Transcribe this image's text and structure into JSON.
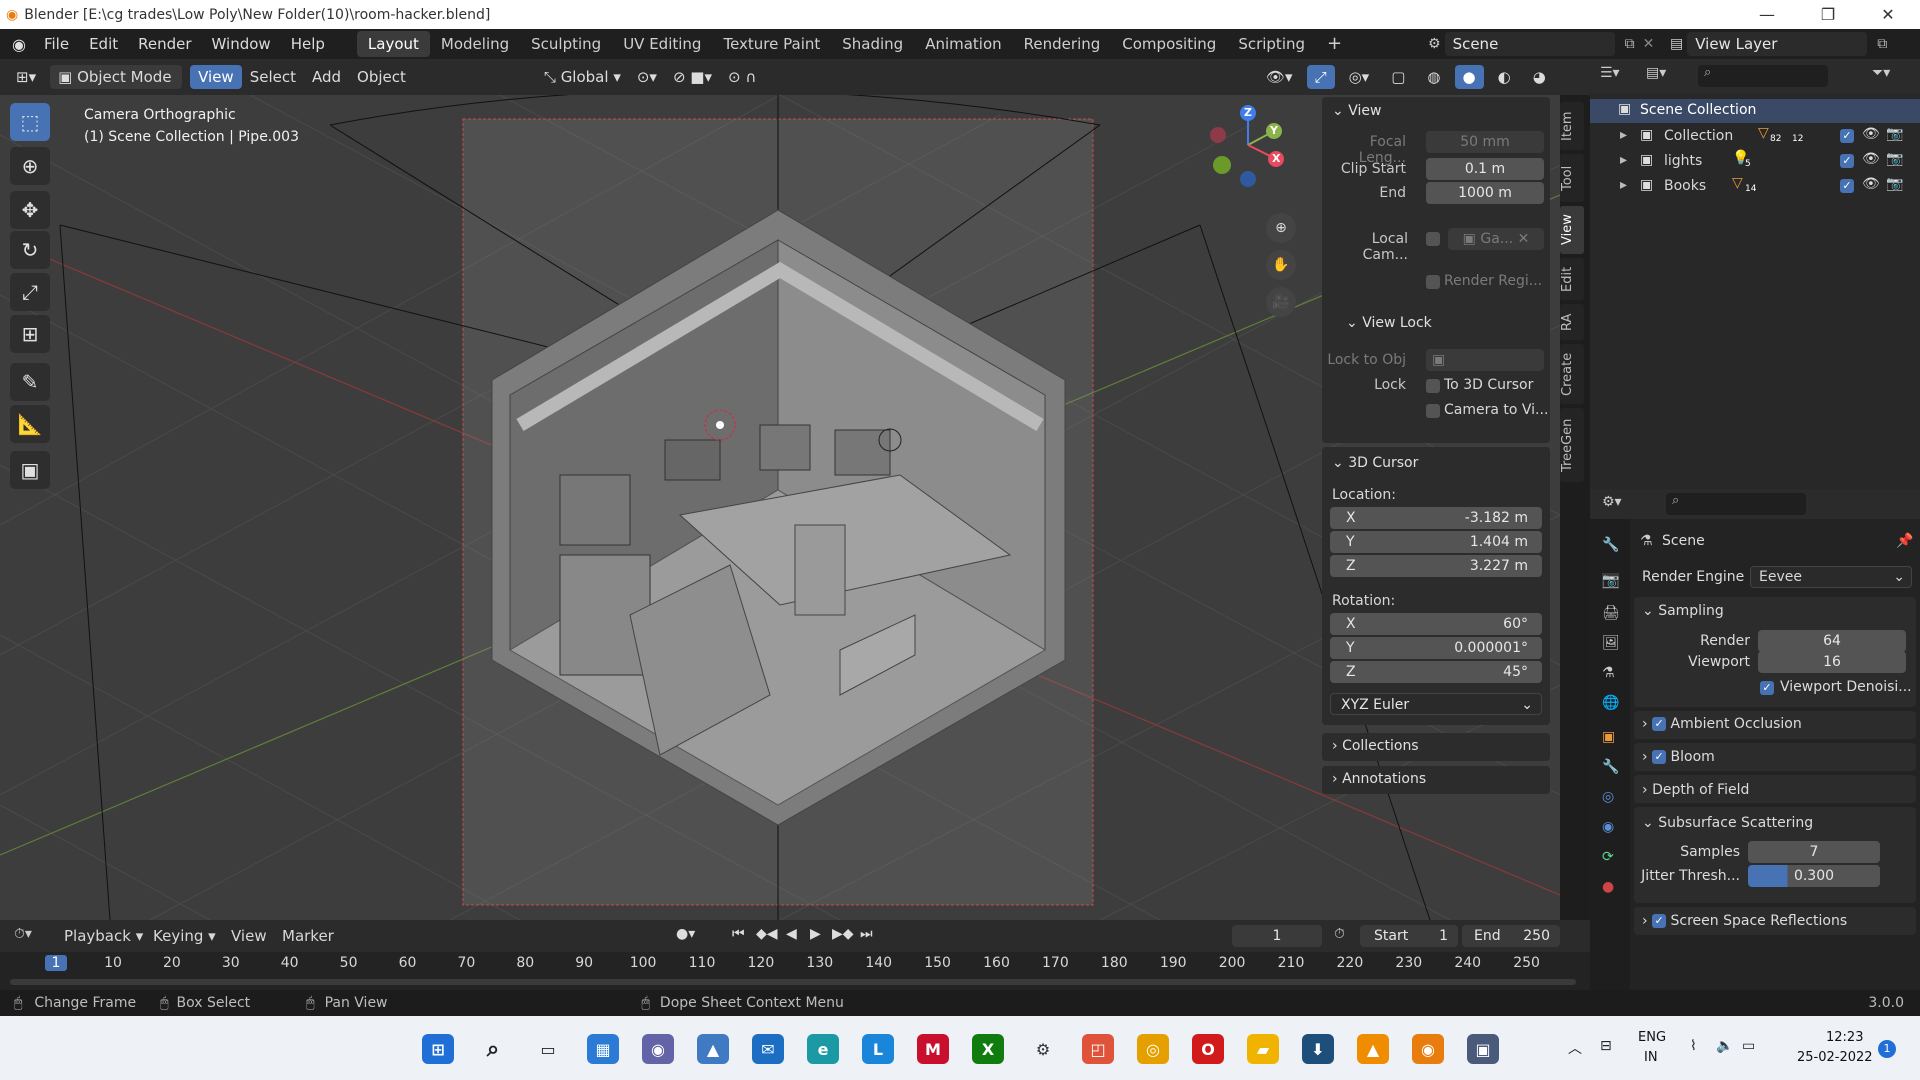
{
  "titlebar": {
    "title": "Blender [E:\\cg trades\\Low Poly\\New Folder(10)\\room-hacker.blend]"
  },
  "menu": [
    "File",
    "Edit",
    "Render",
    "Window",
    "Help"
  ],
  "workspaces": [
    "Layout",
    "Modeling",
    "Sculpting",
    "UV Editing",
    "Texture Paint",
    "Shading",
    "Animation",
    "Rendering",
    "Compositing",
    "Scripting"
  ],
  "scene_field": "Scene",
  "viewlayer_field": "View Layer",
  "header": {
    "mode": "Object Mode",
    "view": "View",
    "select": "Select",
    "add": "Add",
    "object": "Object",
    "transform": "Global"
  },
  "viewport": {
    "camera_label": "Camera Orthographic",
    "object_label": "(1) Scene Collection | Pipe.003"
  },
  "gizmo": {
    "x": "X",
    "y": "Y",
    "z": "Z"
  },
  "npanel": {
    "view_title": "View",
    "focal_label": "Focal Leng...",
    "focal_value": "50 mm",
    "clip_start_label": "Clip Start",
    "clip_start_value": "0.1 m",
    "end_label": "End",
    "end_value": "1000 m",
    "local_cam_label": "Local Cam...",
    "local_cam_value": "Ga...",
    "render_region": "Render Regi...",
    "view_lock_title": "View Lock",
    "lock_to_obj": "Lock to Obj",
    "lock_label": "Lock",
    "to_3d_cursor": "To 3D Cursor",
    "camera_to_view": "Camera to Vi...",
    "cursor_title": "3D Cursor",
    "location_label": "Location:",
    "loc_x": "-3.182 m",
    "loc_y": "1.404 m",
    "loc_z": "3.227 m",
    "rotation_label": "Rotation:",
    "rot_x": "60°",
    "rot_y": "0.000001°",
    "rot_z": "45°",
    "euler": "XYZ Euler",
    "collections": "Collections",
    "annotations": "Annotations",
    "axis_x": "X",
    "axis_y": "Y",
    "axis_z": "Z"
  },
  "side_tabs": [
    "Item",
    "Tool",
    "View",
    "Edit",
    "RA",
    "Create",
    "TreeGen"
  ],
  "outliner": {
    "root": "Scene Collection",
    "items": [
      {
        "name": "Collection",
        "badge1": "82",
        "badge2": "12"
      },
      {
        "name": "lights",
        "badge1": "5"
      },
      {
        "name": "Books",
        "badge1": "14"
      }
    ]
  },
  "properties": {
    "scene": "Scene",
    "render_engine_label": "Render Engine",
    "render_engine": "Eevee",
    "sampling": "Sampling",
    "render_label": "Render",
    "render_value": "64",
    "viewport_label": "Viewport",
    "viewport_value": "16",
    "viewport_denoise": "Viewport Denoisi...",
    "ambient_occlusion": "Ambient Occlusion",
    "bloom": "Bloom",
    "depth_of_field": "Depth of Field",
    "subsurface": "Subsurface Scattering",
    "samples_label": "Samples",
    "samples_value": "7",
    "jitter_label": "Jitter Thresh...",
    "jitter_value": "0.300",
    "ssr": "Screen Space Reflections"
  },
  "timeline": {
    "playback": "Playback",
    "keying": "Keying",
    "view": "View",
    "marker": "Marker",
    "current_frame": "1",
    "start_label": "Start",
    "start_value": "1",
    "end_label": "End",
    "end_value": "250",
    "ticks": [
      "1",
      "10",
      "20",
      "30",
      "40",
      "50",
      "60",
      "70",
      "80",
      "90",
      "100",
      "110",
      "120",
      "130",
      "140",
      "150",
      "160",
      "170",
      "180",
      "190",
      "200",
      "210",
      "220",
      "230",
      "240",
      "250"
    ]
  },
  "status": {
    "change_frame": "Change Frame",
    "box_select": "Box Select",
    "pan_view": "Pan View",
    "context_menu": "Dope Sheet Context Menu",
    "version": "3.0.0"
  },
  "taskbar": {
    "lang1": "ENG",
    "lang2": "IN",
    "time": "12:23",
    "date": "25-02-2022",
    "notif": "1"
  }
}
